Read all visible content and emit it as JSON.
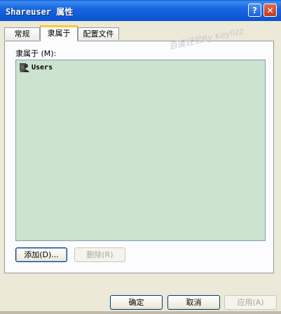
{
  "window": {
    "title": "Shareuser 属性",
    "help_glyph": "?",
    "close_glyph": "✕"
  },
  "tabs": [
    {
      "label": "常规"
    },
    {
      "label": "隶属于"
    },
    {
      "label": "配置文件"
    }
  ],
  "watermark": "百度经验By Keylizz",
  "memberof": {
    "label": "隶属于 (M):",
    "items": [
      {
        "name": "Users",
        "icon": "users-group-icon"
      }
    ]
  },
  "buttons": {
    "add": "添加(D)...",
    "remove": "删除(R)",
    "ok": "确定",
    "cancel": "取消",
    "apply": "应用(A)"
  },
  "colors": {
    "listbox_bg": "#cbe3cf",
    "titlebar": "#0a52d0",
    "active_tab_accent": "#ffc83c"
  }
}
